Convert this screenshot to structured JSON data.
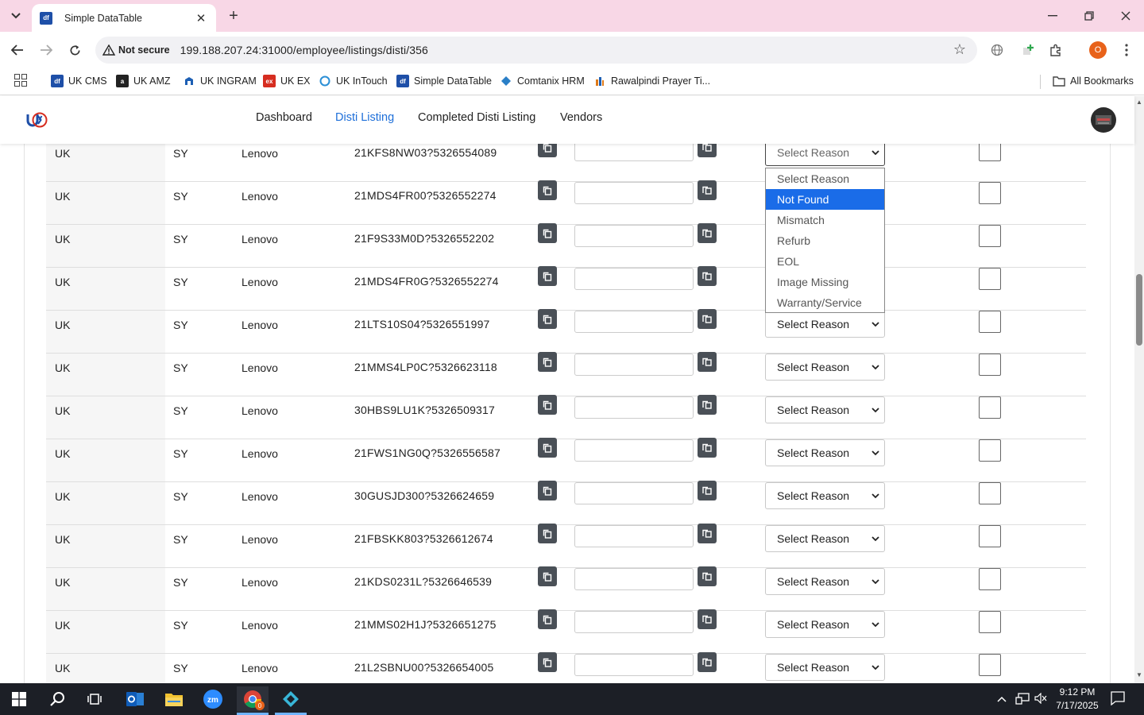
{
  "browser": {
    "tab_title": "Simple DataTable",
    "security_label": "Not secure",
    "url": "199.188.207.24:31000/employee/listings/disti/356",
    "profile_initial": "O",
    "bookmarks": [
      {
        "label": "UK CMS",
        "icon": "df-icon",
        "color": "#1e4fa8"
      },
      {
        "label": "UK AMZ",
        "icon": "amazon-icon",
        "color": "#222222"
      },
      {
        "label": "UK INGRAM",
        "icon": "ingram-icon",
        "color": "#1d5fb4"
      },
      {
        "label": "UK EX",
        "icon": "ex-icon",
        "color": "#d62d20"
      },
      {
        "label": "UK InTouch",
        "icon": "intouch-icon",
        "color": "#2b8fd6"
      },
      {
        "label": "Simple DataTable",
        "icon": "df-icon",
        "color": "#1e4fa8"
      },
      {
        "label": "Comtanix HRM",
        "icon": "hrm-icon",
        "color": "#2a7fc7"
      },
      {
        "label": "Rawalpindi Prayer Ti...",
        "icon": "prayer-icon",
        "color": "#e07b1a"
      }
    ],
    "all_bookmarks": "All Bookmarks"
  },
  "nav": {
    "links": [
      "Dashboard",
      "Disti Listing",
      "Completed Disti Listing",
      "Vendors"
    ],
    "active": "Disti Listing"
  },
  "rows": [
    {
      "country": "UK",
      "location": "SY",
      "brand": "Lenovo",
      "part": "21KFS8NW03?5326554089",
      "reason": "Select Reason"
    },
    {
      "country": "UK",
      "location": "SY",
      "brand": "Lenovo",
      "part": "21MDS4FR00?5326552274",
      "reason": "Select Reason"
    },
    {
      "country": "UK",
      "location": "SY",
      "brand": "Lenovo",
      "part": "21F9S33M0D?5326552202",
      "reason": "Select Reason"
    },
    {
      "country": "UK",
      "location": "SY",
      "brand": "Lenovo",
      "part": "21MDS4FR0G?5326552274",
      "reason": "Select Reason"
    },
    {
      "country": "UK",
      "location": "SY",
      "brand": "Lenovo",
      "part": "21LTS10S04?5326551997",
      "reason": "Select Reason"
    },
    {
      "country": "UK",
      "location": "SY",
      "brand": "Lenovo",
      "part": "21MMS4LP0C?5326623118",
      "reason": "Select Reason"
    },
    {
      "country": "UK",
      "location": "SY",
      "brand": "Lenovo",
      "part": "30HBS9LU1K?5326509317",
      "reason": "Select Reason"
    },
    {
      "country": "UK",
      "location": "SY",
      "brand": "Lenovo",
      "part": "21FWS1NG0Q?5326556587",
      "reason": "Select Reason"
    },
    {
      "country": "UK",
      "location": "SY",
      "brand": "Lenovo",
      "part": "30GUSJD300?5326624659",
      "reason": "Select Reason"
    },
    {
      "country": "UK",
      "location": "SY",
      "brand": "Lenovo",
      "part": "21FBSKK803?5326612674",
      "reason": "Select Reason"
    },
    {
      "country": "UK",
      "location": "SY",
      "brand": "Lenovo",
      "part": "21KDS0231L?5326646539",
      "reason": "Select Reason"
    },
    {
      "country": "UK",
      "location": "SY",
      "brand": "Lenovo",
      "part": "21MMS02H1J?5326651275",
      "reason": "Select Reason"
    },
    {
      "country": "UK",
      "location": "SY",
      "brand": "Lenovo",
      "part": "21L2SBNU00?5326654005",
      "reason": "Select Reason"
    }
  ],
  "dropdown": {
    "options": [
      "Select Reason",
      "Not Found",
      "Mismatch",
      "Refurb",
      "EOL",
      "Image Missing",
      "Warranty/Service"
    ],
    "highlighted": "Not Found"
  },
  "taskbar": {
    "time": "9:12 PM",
    "date": "7/17/2025",
    "apps": [
      "windows-start-icon",
      "search-icon",
      "task-view-icon",
      "outlook-icon",
      "file-explorer-icon",
      "zoom-icon",
      "chrome-icon",
      "app-icon"
    ],
    "chrome_badge": "0"
  }
}
